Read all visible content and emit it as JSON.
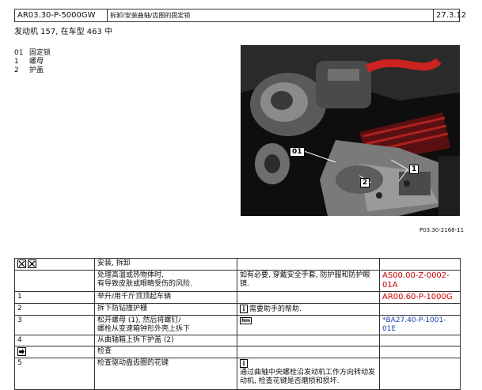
{
  "header": {
    "doc_id": "AR03.30-P-5000GW",
    "title": "拆卸/安装曲轴/齿圈的固定锁",
    "date": "27.3.12"
  },
  "subtitle": "发动机   157, 在车型 463 中",
  "legend": [
    {
      "num": "01",
      "label": "固定锁"
    },
    {
      "num": "1",
      "label": "螺母"
    },
    {
      "num": "2",
      "label": "护盖"
    }
  ],
  "photo": {
    "callouts": [
      "01",
      "1",
      "2"
    ],
    "caption": "P03.30-2168-11"
  },
  "table": {
    "rows": [
      {
        "num": "",
        "icon": "remove-install-icons",
        "desc": "安装, 拆卸",
        "note": "",
        "ref": ""
      },
      {
        "num": "",
        "icon": "",
        "desc": "处理高温或热物体时,\n有导致皮肤或眼睛受伤的风险.",
        "note": "如有必要, 穿戴安全手套, 防护服和防护眼镜.",
        "ref": "AS00.00-Z-0002-01A"
      },
      {
        "num": "1",
        "icon": "",
        "desc": "举升/用千斤顶顶起车辆",
        "note": "",
        "ref": "AR00.60-P-1000G"
      },
      {
        "num": "2",
        "icon": "",
        "desc": "拆下防钻撞护栅",
        "note": "需要助手的帮助.",
        "ref": ""
      },
      {
        "num": "3",
        "icon": "",
        "desc": "松开螺母 (1), 然后将螺钉/\n螺栓从变速箱钟形外壳上拆下",
        "note": "Nm",
        "ref": "*BA27.40-P-1001-01E"
      },
      {
        "num": "4",
        "icon": "",
        "desc": "从曲轴箱上拆下护盖 (2)",
        "note": "",
        "ref": ""
      },
      {
        "num": "",
        "icon": "check-icon",
        "desc": "检查",
        "note": "",
        "ref": ""
      },
      {
        "num": "5",
        "icon": "",
        "desc": "检查驱动盘齿圈的花键",
        "note": "通过曲轴中央螺栓沿发动机工作方向转动发动机, 检查花键是否磨损和损坏.",
        "ref": ""
      }
    ]
  }
}
